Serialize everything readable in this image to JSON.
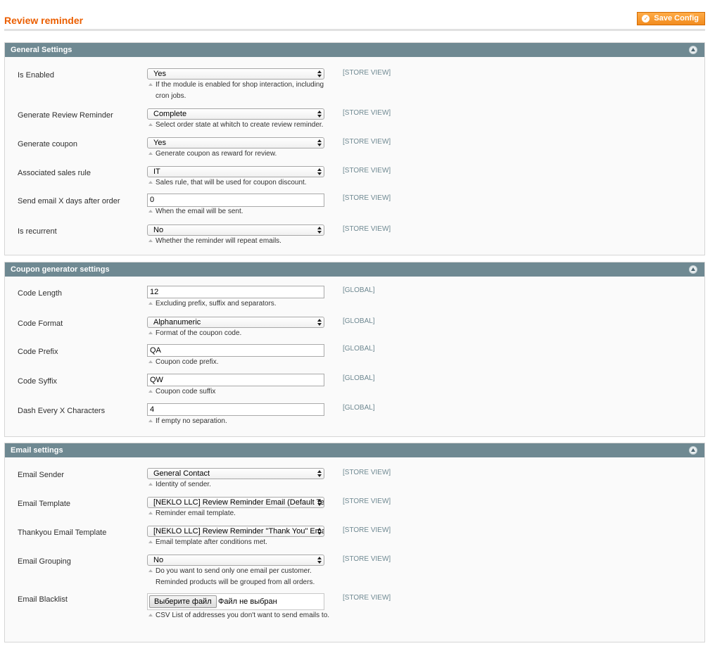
{
  "header": {
    "title": "Review reminder",
    "save_label": "Save Config"
  },
  "sections": {
    "general": {
      "title": "General Settings",
      "rows": [
        {
          "label": "Is Enabled",
          "value": "Yes",
          "note": "If the module is enabled for shop interaction, including cron jobs.",
          "scope": "[STORE VIEW]"
        },
        {
          "label": "Generate Review Reminder",
          "value": "Complete",
          "note": "Select order state at whitch to create review reminder.",
          "scope": "[STORE VIEW]"
        },
        {
          "label": "Generate coupon",
          "value": "Yes",
          "note": "Generate coupon as reward for review.",
          "scope": "[STORE VIEW]"
        },
        {
          "label": "Associated sales rule",
          "value": "IT",
          "note": "Sales rule, that will be used for coupon discount.",
          "scope": "[STORE VIEW]"
        },
        {
          "label": "Send email X days after order",
          "value": "0",
          "note": "When the email will be sent.",
          "scope": "[STORE VIEW]"
        },
        {
          "label": "Is recurrent",
          "value": "No",
          "note": "Whether the reminder will repeat emails.",
          "scope": "[STORE VIEW]"
        }
      ]
    },
    "coupon": {
      "title": "Coupon generator settings",
      "rows": [
        {
          "label": "Code Length",
          "value": "12",
          "note": "Excluding prefix, suffix and separators.",
          "scope": "[GLOBAL]"
        },
        {
          "label": "Code Format",
          "value": "Alphanumeric",
          "note": "Format of the coupon code.",
          "scope": "[GLOBAL]"
        },
        {
          "label": "Code Prefix",
          "value": "QA",
          "note": "Coupon code prefix.",
          "scope": "[GLOBAL]"
        },
        {
          "label": "Code Syffix",
          "value": "QW",
          "note": "Coupon code suffix",
          "scope": "[GLOBAL]"
        },
        {
          "label": "Dash Every X Characters",
          "value": "4",
          "note": "If empty no separation.",
          "scope": "[GLOBAL]"
        }
      ]
    },
    "email": {
      "title": "Email settings",
      "rows": [
        {
          "label": "Email Sender",
          "value": "General Contact",
          "note": "Identity of sender.",
          "scope": "[STORE VIEW]"
        },
        {
          "label": "Email Template",
          "value": "[NEKLO LLC] Review Reminder Email (Default Template from Locale)",
          "note": "Reminder email template.",
          "scope": "[STORE VIEW]"
        },
        {
          "label": "Thankyou Email Template",
          "value": "[NEKLO LLC] Review Reminder \"Thank You\" Email",
          "note": "Email template after conditions met.",
          "scope": "[STORE VIEW]"
        },
        {
          "label": "Email Grouping",
          "value": "No",
          "note": "Do you want to send only one email per customer. Reminded products will be grouped from all orders.",
          "scope": "[STORE VIEW]"
        },
        {
          "label": "Email Blacklist",
          "button": "Выберите файл",
          "value": "Файл не выбран",
          "note": "CSV List of addresses you don't want to send emails to.",
          "scope": "[STORE VIEW]"
        }
      ]
    }
  }
}
